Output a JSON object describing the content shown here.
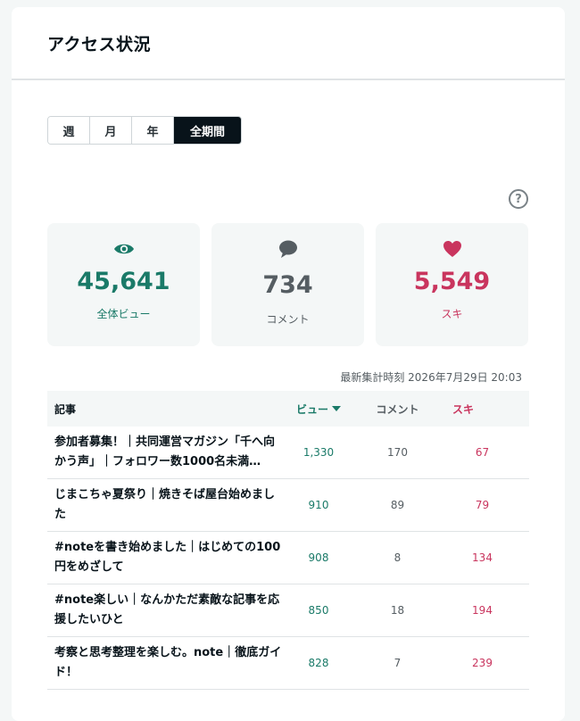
{
  "header": {
    "title": "アクセス状況"
  },
  "tabs": [
    {
      "label": "週",
      "active": false
    },
    {
      "label": "月",
      "active": false
    },
    {
      "label": "年",
      "active": false
    },
    {
      "label": "全期間",
      "active": true
    }
  ],
  "help": {
    "glyph": "?"
  },
  "stats": {
    "views": {
      "value": "45,641",
      "label": "全体ビュー",
      "icon": "eye-icon"
    },
    "comments": {
      "value": "734",
      "label": "コメント",
      "icon": "comment-icon"
    },
    "likes": {
      "value": "5,549",
      "label": "スキ",
      "icon": "heart-icon"
    }
  },
  "updated": "最新集計時刻 2026年7月29日 20:03",
  "table": {
    "headers": {
      "title": "記事",
      "views": "ビュー",
      "comments": "コメント",
      "likes": "スキ"
    },
    "rows": [
      {
        "title": "参加者募集！｜共同運営マガジン「千へ向かう声」｜フォロワー数1000名未満…",
        "views": "1,330",
        "comments": "170",
        "likes": "67"
      },
      {
        "title": "じまこちゃ夏祭り｜焼きそば屋台始めました",
        "views": "910",
        "comments": "89",
        "likes": "79"
      },
      {
        "title": "#noteを書き始めました｜はじめての100円をめざして",
        "views": "908",
        "comments": "8",
        "likes": "134"
      },
      {
        "title": "#note楽しい｜なんかただ素敵な記事を応援したいひと",
        "views": "850",
        "comments": "18",
        "likes": "194"
      },
      {
        "title": "考察と思考整理を楽しむ。note｜徹底ガイド！",
        "views": "828",
        "comments": "7",
        "likes": "239"
      }
    ]
  },
  "colors": {
    "views": "#1a7a68",
    "comments": "#555d62",
    "likes": "#c9355e",
    "dark": "#08131a"
  }
}
